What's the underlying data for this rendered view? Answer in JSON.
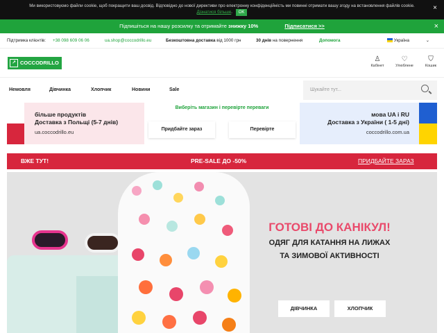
{
  "cookie": {
    "text": "Ми використовуємо файли cookie, щоб покращити ваш досвід. Відповідно до нової директиви про електронну конфіденційність ми повинні отримати вашу згоду на встановлення файлів cookie.",
    "more_link": "Дізнатися більше",
    "ok_label": "OK",
    "close": "×"
  },
  "newsletter": {
    "text": "Підпишіться на нашу розсилку та отримайте",
    "bold": "знижку 10%",
    "subscribe": "Підписатися >>",
    "close": "×"
  },
  "topbar": {
    "support_label": "Підтримка клієнтів:",
    "phone": "+38 098 609 06 06",
    "email": "ua.shop@coccodrillo.eu",
    "delivery_bold": "Безкоштовна доставка",
    "delivery_rest": "від 1000 грн",
    "return_bold": "30 днів",
    "return_rest": "на повернення",
    "help": "Допомога",
    "country": "Україна"
  },
  "header": {
    "logo": "COCCODRILLO",
    "account": "Кабінет",
    "favorites": "Улюблене",
    "cart": "Кошик"
  },
  "nav": {
    "items": [
      "Немовля",
      "Дівчинка",
      "Хлопчик",
      "Новини",
      "Sale"
    ]
  },
  "search": {
    "placeholder": "Шукайте тут..."
  },
  "promo": {
    "left_line1": "більше продуктів",
    "left_line2": "Доставка з Польщі (5-7 днів)",
    "left_url": "ua.coccodrillo.eu",
    "center_title": "Виберіть магазин і перевірте переваги",
    "btn_buy": "Придбайте зараз",
    "btn_check": "Перевірте",
    "right_line1": "мова UA і RU",
    "right_line2": "Доставка з України ( 1-5 дні)",
    "right_url": "coccodrillo.com.ua"
  },
  "sale_banner": {
    "left": "ВЖЕ ТУТ!",
    "center": "PRE-SALE ДО -50%",
    "right": "ПРИДБАЙТЕ ЗАРАЗ"
  },
  "hero": {
    "title": "ГОТОВІ ДО КАНІКУЛ!",
    "line1": "ОДЯГ ДЛЯ КАТАННЯ НА ЛИЖАХ",
    "line2": "ТА ЗИМОВОЇ АКТИВНОСТІ",
    "btn_girl": "ДІВЧИНКА",
    "btn_boy": "ХЛОПЧИК"
  },
  "colors": {
    "green": "#1fa33b",
    "red": "#d7263d",
    "pink_title": "#e94a6b"
  }
}
